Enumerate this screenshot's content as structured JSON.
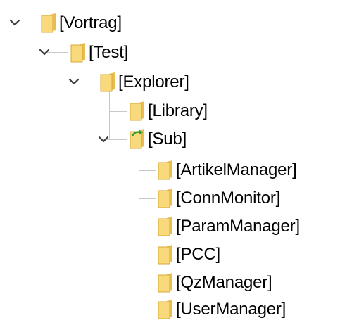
{
  "tree": {
    "nodes": [
      {
        "label": "[Vortrag]",
        "expanded": true,
        "icon": "folder-icon"
      },
      {
        "label": "[Test]",
        "expanded": true,
        "icon": "folder-icon"
      },
      {
        "label": "[Explorer]",
        "expanded": true,
        "icon": "folder-icon"
      },
      {
        "label": "[Library]",
        "icon": "folder-icon"
      },
      {
        "label": "[Sub]",
        "expanded": true,
        "icon": "shared-folder-icon"
      },
      {
        "label": "[ArtikelManager]",
        "icon": "folder-icon"
      },
      {
        "label": "[ConnMonitor]",
        "icon": "folder-icon"
      },
      {
        "label": "[ParamManager]",
        "icon": "folder-icon"
      },
      {
        "label": "[PCC]",
        "icon": "folder-icon"
      },
      {
        "label": "[QzManager]",
        "icon": "folder-icon"
      },
      {
        "label": "[UserManager]",
        "icon": "folder-icon"
      }
    ]
  },
  "colors": {
    "folder_fill": "#f8da7c",
    "folder_back": "#e9bd50",
    "folder_edge": "#d9a935",
    "chevron": "#3c3c3c",
    "guide_line": "#c8c8c8",
    "shared_arrow": "#2e9a2e"
  }
}
